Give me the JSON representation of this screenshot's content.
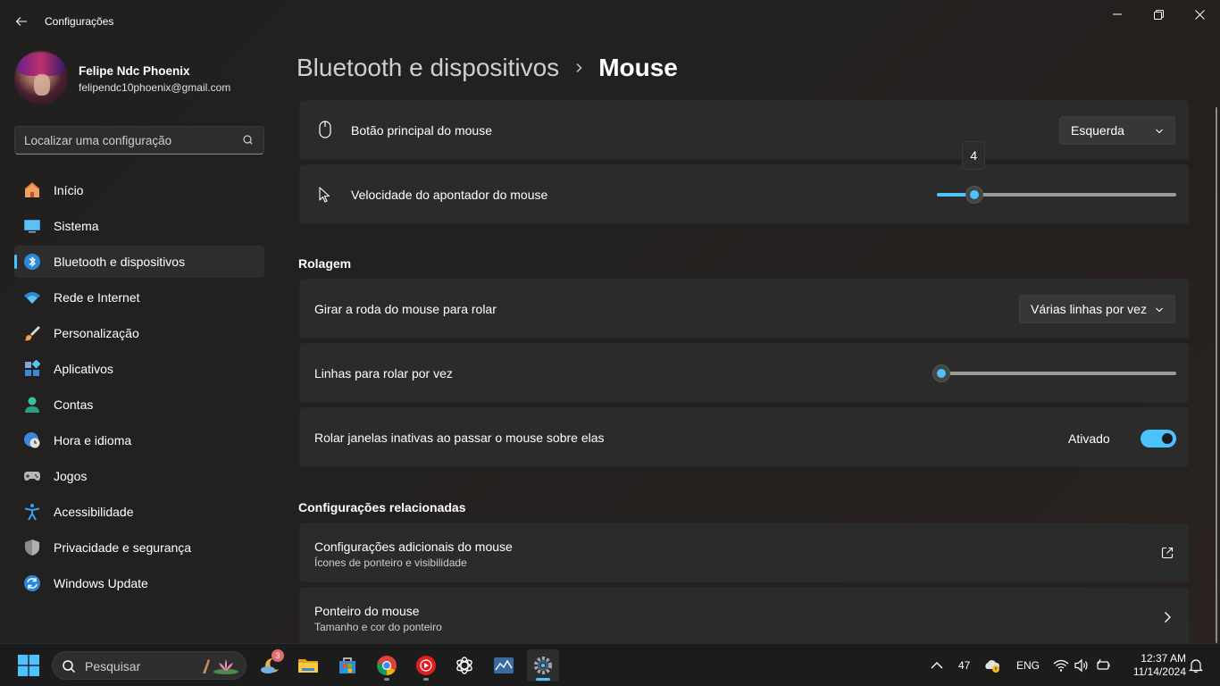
{
  "titlebar": {
    "title": "Configurações"
  },
  "profile": {
    "name": "Felipe Ndc Phoenix",
    "email": "felipendc10phoenix@gmail.com"
  },
  "search": {
    "placeholder": "Localizar uma configuração"
  },
  "sidebar": {
    "items": [
      {
        "label": "Início",
        "icon": "home-icon"
      },
      {
        "label": "Sistema",
        "icon": "monitor-icon"
      },
      {
        "label": "Bluetooth e dispositivos",
        "icon": "bluetooth-icon",
        "active": true
      },
      {
        "label": "Rede e Internet",
        "icon": "wifi-icon"
      },
      {
        "label": "Personalização",
        "icon": "brush-icon"
      },
      {
        "label": "Aplicativos",
        "icon": "apps-icon"
      },
      {
        "label": "Contas",
        "icon": "person-icon"
      },
      {
        "label": "Hora e idioma",
        "icon": "globe-clock-icon"
      },
      {
        "label": "Jogos",
        "icon": "gamepad-icon"
      },
      {
        "label": "Acessibilidade",
        "icon": "accessibility-icon"
      },
      {
        "label": "Privacidade e segurança",
        "icon": "shield-icon"
      },
      {
        "label": "Windows Update",
        "icon": "update-icon"
      }
    ]
  },
  "header": {
    "parent": "Bluetooth e dispositivos",
    "current": "Mouse"
  },
  "mouse": {
    "primary_button": {
      "label": "Botão principal do mouse",
      "value": "Esquerda"
    },
    "pointer_speed": {
      "label": "Velocidade do apontador do mouse",
      "value": 4,
      "min": 1,
      "max": 20,
      "tooltip": "4"
    }
  },
  "scroll": {
    "title": "Rolagem",
    "wheel": {
      "label": "Girar a roda do mouse para rolar",
      "value": "Várias linhas por vez"
    },
    "lines": {
      "label": "Linhas para rolar por vez",
      "value": 3,
      "min": 1,
      "max": 100
    },
    "inactive": {
      "label": "Rolar janelas inativas ao passar o mouse sobre elas",
      "state": "Ativado",
      "on": true
    }
  },
  "related": {
    "title": "Configurações relacionadas",
    "items": [
      {
        "label": "Configurações adicionais do mouse",
        "sub": "Ícones de ponteiro e visibilidade",
        "icon": "external-link-icon"
      },
      {
        "label": "Ponteiro do mouse",
        "sub": "Tamanho e cor do ponteiro",
        "icon": "chevron-right-icon"
      }
    ]
  },
  "taskbar": {
    "search_placeholder": "Pesquisar",
    "weather_badge": "3",
    "tray": {
      "number": "47",
      "lang": "ENG",
      "time": "12:37 AM",
      "date": "11/14/2024"
    }
  },
  "colors": {
    "accent": "#4cc2ff",
    "background": "#202020",
    "card": "#2b2b2b"
  }
}
